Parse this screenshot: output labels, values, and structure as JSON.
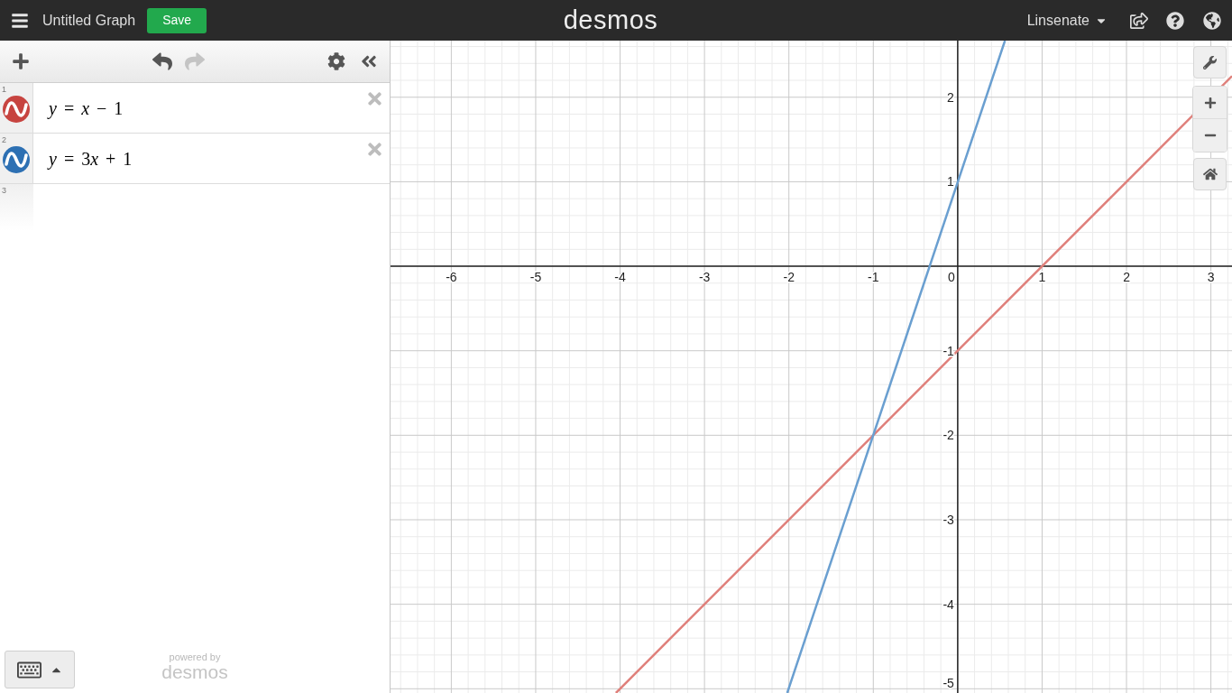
{
  "top_bar": {
    "title": "Untitled Graph",
    "save_button": "Save",
    "logo": "desmos",
    "user_menu": "Linsenate"
  },
  "expression_toolbar": {
    "history": [
      {
        "kind": "undo",
        "disabled": false
      },
      {
        "kind": "redo",
        "disabled": true
      }
    ]
  },
  "expressions": [
    {
      "index": "1",
      "text": "y = x − 1",
      "color": "#c74440"
    },
    {
      "index": "2",
      "text": "y = 3x + 1",
      "color": "#2d70b3"
    },
    {
      "index": "3"
    }
  ],
  "footer": {
    "caption": "powered by",
    "logo": "desmos"
  },
  "graph": {
    "chart_data": [
      {
        "type": "line",
        "xlim": [
          -6.72,
          3.25
        ],
        "ylim": [
          -5.05,
          2.67
        ],
        "xticks": [
          -6,
          -5,
          -4,
          -3,
          -2,
          -1,
          0,
          1,
          2,
          3
        ],
        "yticks": [
          -5,
          -4,
          -3,
          -2,
          -1,
          1,
          2
        ],
        "grid": true,
        "series": [
          {
            "color": "#df7f7a",
            "x": [
              -4.05,
              3.25
            ],
            "values": [
              -5.05,
              2.25
            ]
          },
          {
            "color": "#6a9fd0",
            "x": [
              -2.02,
              0.56
            ],
            "values": [
              -5.05,
              2.67
            ]
          }
        ]
      }
    ]
  }
}
